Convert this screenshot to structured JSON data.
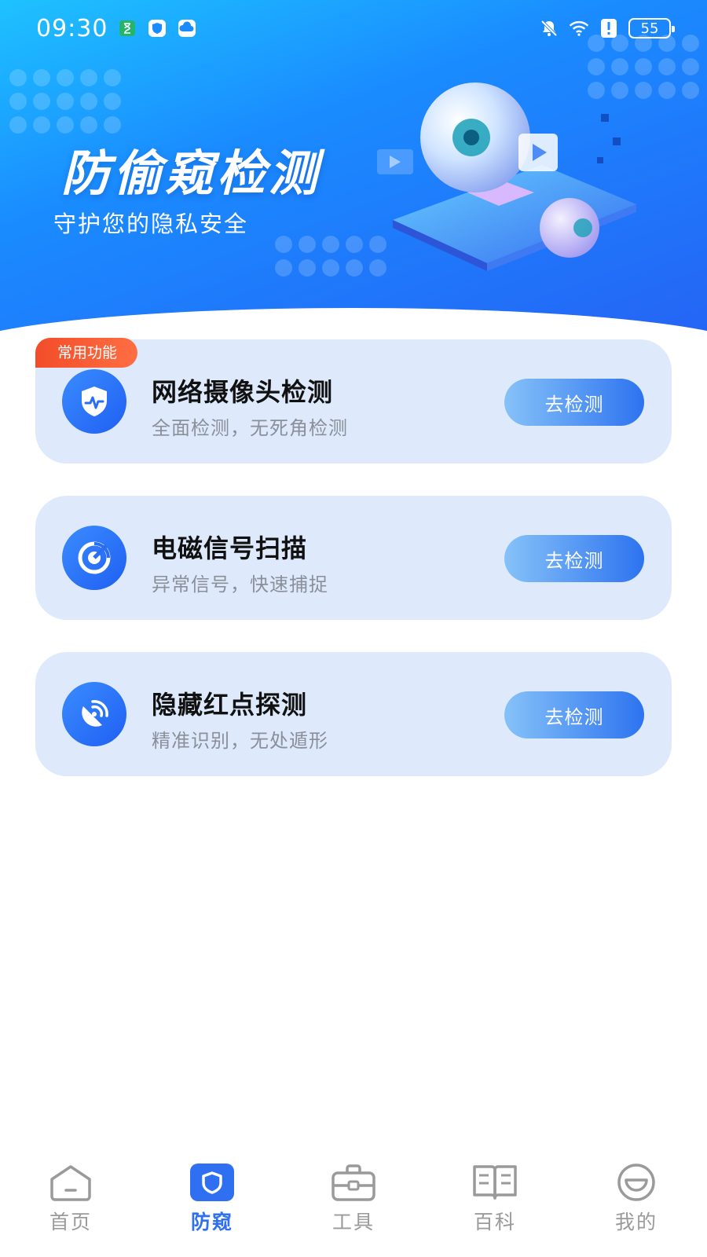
{
  "status_bar": {
    "time": "09:30",
    "battery": "55",
    "icons": [
      "hourglass-icon",
      "shield-app-icon",
      "cloud-app-icon",
      "bell-off-icon",
      "wifi-icon",
      "alert-icon",
      "battery-icon"
    ]
  },
  "hero": {
    "title": "防偷窥检测",
    "subtitle": "守护您的隐私安全"
  },
  "cards": [
    {
      "tag": "常用功能",
      "icon": "shield-pulse-icon",
      "title": "网络摄像头检测",
      "desc": "全面检测，无死角检测",
      "button": "去检测"
    },
    {
      "icon": "radar-icon",
      "title": "电磁信号扫描",
      "desc": "异常信号，快速捕捉",
      "button": "去检测"
    },
    {
      "icon": "satellite-dish-icon",
      "title": "隐藏红点探测",
      "desc": "精准识别，无处遁形",
      "button": "去检测"
    }
  ],
  "bottom_nav": [
    {
      "label": "首页",
      "icon": "home-icon",
      "active": false
    },
    {
      "label": "防窥",
      "icon": "shield-icon",
      "active": true
    },
    {
      "label": "工具",
      "icon": "toolbox-icon",
      "active": false
    },
    {
      "label": "百科",
      "icon": "book-icon",
      "active": false
    },
    {
      "label": "我的",
      "icon": "smile-face-icon",
      "active": false
    }
  ],
  "colors": {
    "hero_start": "#1ec2ff",
    "hero_end": "#2563f5",
    "card_bg": "#deeafc",
    "tag_bg": "#f24d2a",
    "accent": "#2f6ff1",
    "nav_inactive": "#9a9a9a"
  }
}
